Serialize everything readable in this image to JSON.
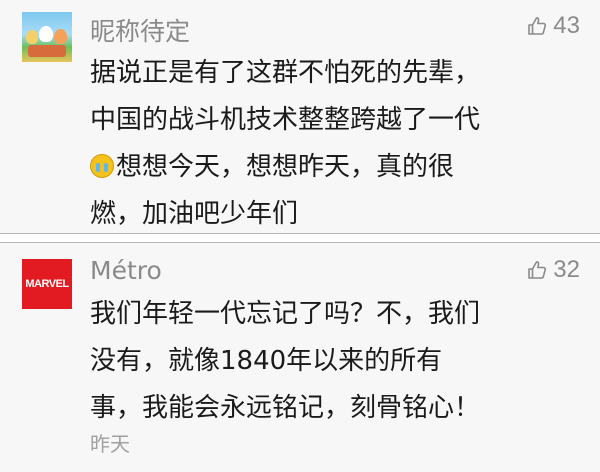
{
  "comments": [
    {
      "username": "昵称待定",
      "likes": "43",
      "avatar_icon": "cartoon-avatar-icon",
      "lines": [
        "据说正是有了这群不怕死的先辈，",
        "中国的战斗机技术整整跨越了一代",
        "想想今天，想想昨天，真的很",
        "燃，加油吧少年们"
      ],
      "emoji_icon": "crying-face-emoji"
    },
    {
      "username": "Métro",
      "likes": "32",
      "avatar_text": "MARVEL",
      "lines": [
        "我们年轻一代忘记了吗？不，我们",
        "没有，就像1840年以来的所有",
        "事，我能会永远铭记，刻骨铭心！"
      ],
      "time": "昨天"
    }
  ],
  "colors": {
    "card_bg": "#f7f7f7",
    "meta_gray": "#8a8a8a",
    "text": "#1a1a1a",
    "marvel_red": "#e21b22"
  }
}
